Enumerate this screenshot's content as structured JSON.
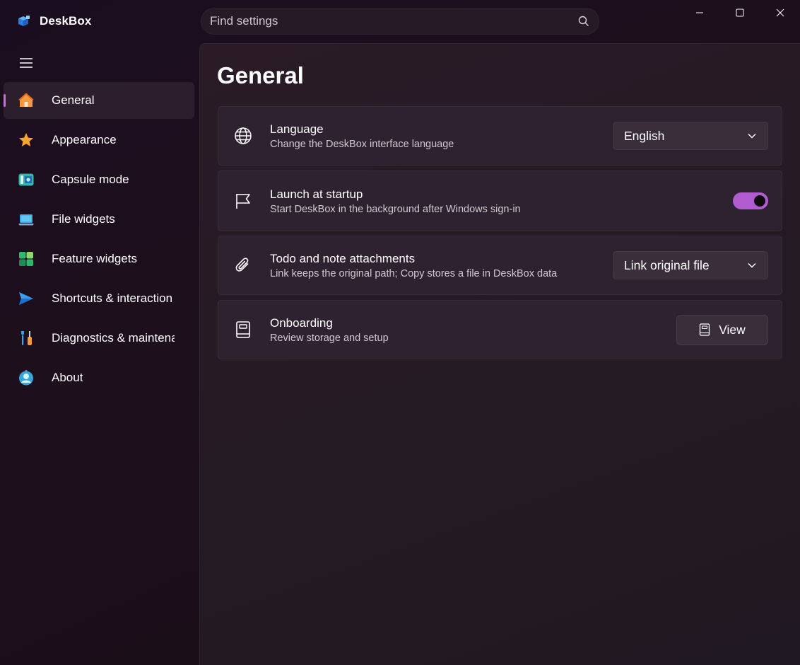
{
  "app": {
    "title": "DeskBox"
  },
  "search": {
    "placeholder": "Find settings"
  },
  "sidebar": {
    "items": [
      {
        "label": "General",
        "icon": "home-icon",
        "selected": true
      },
      {
        "label": "Appearance",
        "icon": "star-icon"
      },
      {
        "label": "Capsule mode",
        "icon": "capsule-icon"
      },
      {
        "label": "File widgets",
        "icon": "laptop-icon"
      },
      {
        "label": "Feature widgets",
        "icon": "widgets-icon"
      },
      {
        "label": "Shortcuts & interaction",
        "icon": "send-icon"
      },
      {
        "label": "Diagnostics & maintenance",
        "icon": "tools-icon"
      },
      {
        "label": "About",
        "icon": "bot-icon"
      }
    ]
  },
  "page": {
    "title": "General",
    "settings": [
      {
        "title": "Language",
        "description": "Change the DeskBox interface language",
        "icon": "globe-icon",
        "control": "dropdown",
        "value": "English"
      },
      {
        "title": "Launch at startup",
        "description": "Start DeskBox in the background after Windows sign-in",
        "icon": "flag-icon",
        "control": "toggle",
        "on": true
      },
      {
        "title": "Todo and note attachments",
        "description": "Link keeps the original path; Copy stores a file in DeskBox data",
        "icon": "paperclip-icon",
        "control": "dropdown",
        "value": "Link original file"
      },
      {
        "title": "Onboarding",
        "description": "Review storage and setup",
        "icon": "book-icon",
        "control": "button",
        "button_label": "View"
      }
    ]
  },
  "colors": {
    "accent": "#b05bd0",
    "selected_indicator": "#c66fe0"
  }
}
